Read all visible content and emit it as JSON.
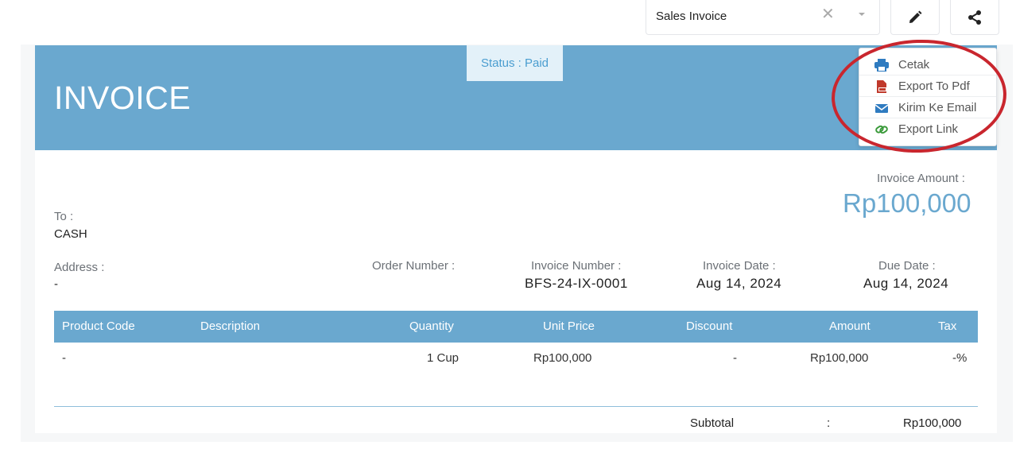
{
  "toolbar": {
    "document_type": "Sales Invoice",
    "clear_glyph": "✕"
  },
  "invoice": {
    "title": "INVOICE",
    "status": "Status : Paid",
    "amount_label": "Invoice Amount :",
    "amount": "Rp100,000",
    "to_label": "To :",
    "to_value": "CASH",
    "address_label": "Address :",
    "address_value": "-",
    "order_number_label": "Order Number :",
    "invoice_number_label": "Invoice Number :",
    "invoice_number": "BFS-24-IX-0001",
    "invoice_date_label": "Invoice Date :",
    "invoice_date": "Aug 14, 2024",
    "due_date_label": "Due Date :",
    "due_date": "Aug 14, 2024"
  },
  "menu": {
    "items": [
      {
        "label": "Cetak",
        "icon": "printer-icon"
      },
      {
        "label": "Export To Pdf",
        "icon": "pdf-icon"
      },
      {
        "label": "Kirim Ke Email",
        "icon": "email-icon"
      },
      {
        "label": "Export Link",
        "icon": "link-icon"
      }
    ]
  },
  "table": {
    "columns": [
      "Product Code",
      "Description",
      "Quantity",
      "Unit Price",
      "Discount",
      "Amount",
      "Tax"
    ],
    "rows": [
      {
        "product_code": "-",
        "description": "",
        "quantity": "1 Cup",
        "unit_price": "Rp100,000",
        "discount": "-",
        "amount": "Rp100,000",
        "tax": "-%"
      }
    ]
  },
  "totals": {
    "subtotal_label": "Subtotal",
    "colon": ":",
    "subtotal_value": "Rp100,000"
  },
  "colors": {
    "header_blue": "#6aa8cf",
    "amount_blue": "#6aa8cf",
    "highlight_red": "#c9262e",
    "pdf_red": "#c0392b",
    "email_blue": "#2f7bc0",
    "link_green": "#3a9a3a"
  }
}
